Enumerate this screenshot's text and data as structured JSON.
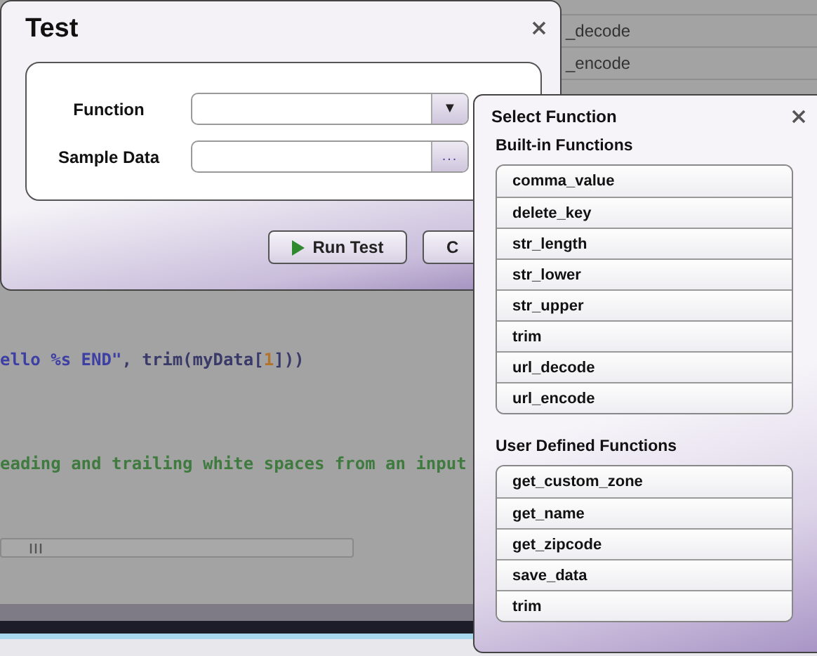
{
  "background": {
    "list_items": [
      "_decode",
      "_encode"
    ],
    "code_lines": [
      {
        "segments": [
          {
            "kind": "string",
            "text": "ello %s END\""
          },
          {
            "kind": "plain",
            "text": ", trim(myData["
          },
          {
            "kind": "number",
            "text": "1"
          },
          {
            "kind": "plain",
            "text": "]))"
          }
        ]
      },
      {
        "segments": [
          {
            "kind": "comment",
            "text": "eading and trailing white spaces from an input"
          }
        ]
      }
    ]
  },
  "test_dialog": {
    "title": "Test",
    "fields": [
      {
        "label": "Function",
        "kind": "dropdown",
        "button": "▼"
      },
      {
        "label": "Sample Data",
        "kind": "browse",
        "button": "..."
      }
    ],
    "buttons": [
      {
        "label": "Run Test",
        "kind": "run"
      },
      {
        "label": "C",
        "kind": "cancel"
      }
    ]
  },
  "select_function": {
    "title": "Select Function",
    "groups": [
      {
        "title": "Built-in Functions",
        "items": [
          "comma_value",
          "delete_key",
          "str_length",
          "str_lower",
          "str_upper",
          "trim",
          "url_decode",
          "url_encode"
        ]
      },
      {
        "title": "User Defined Functions",
        "items": [
          "get_custom_zone",
          "get_name",
          "get_zipcode",
          "save_data",
          "trim"
        ]
      }
    ]
  }
}
